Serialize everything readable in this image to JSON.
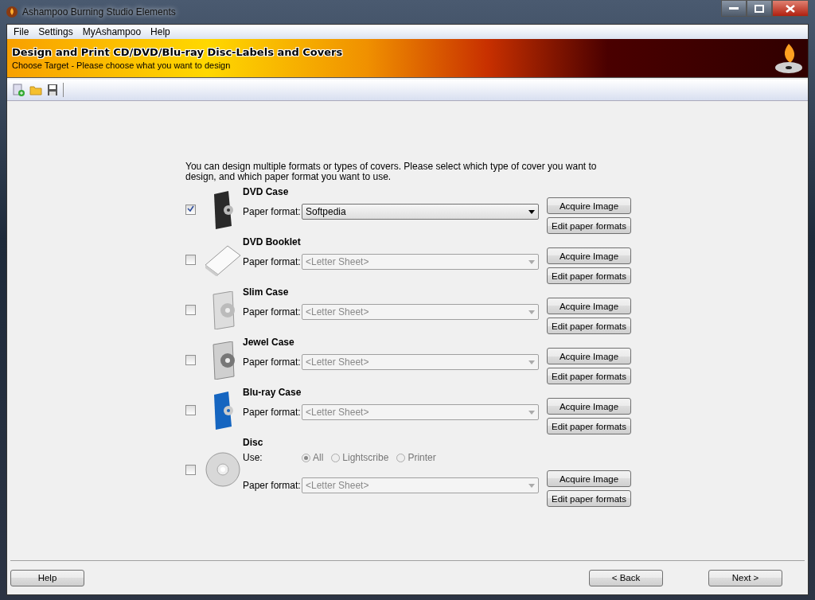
{
  "window": {
    "title": "Ashampoo Burning Studio Elements"
  },
  "menu": [
    "File",
    "Settings",
    "MyAshampoo",
    "Help"
  ],
  "banner": {
    "title": "Design and Print CD/DVD/Blu-ray Disc-Labels and Covers",
    "subtitle": "Choose Target - Please choose what you want to design"
  },
  "intro": "You can design multiple formats or types of covers. Please select which type of cover you want to design, and which paper format you want to use.",
  "items": [
    {
      "kind": "dvd-case",
      "name": "DVD Case",
      "checked": true,
      "paper_label": "Paper format:",
      "paper_value": "Softpedia",
      "buttons": [
        "Acquire Image",
        "Edit paper formats"
      ]
    },
    {
      "kind": "booklet",
      "name": "DVD Booklet",
      "checked": false,
      "paper_label": "Paper format:",
      "paper_value": "<Letter Sheet>",
      "buttons": [
        "Acquire Image",
        "Edit paper formats"
      ]
    },
    {
      "kind": "slim-case",
      "name": "Slim Case",
      "checked": false,
      "paper_label": "Paper format:",
      "paper_value": "<Letter Sheet>",
      "buttons": [
        "Acquire Image",
        "Edit paper formats"
      ]
    },
    {
      "kind": "jewel-case",
      "name": "Jewel Case",
      "checked": false,
      "paper_label": "Paper format:",
      "paper_value": "<Letter Sheet>",
      "buttons": [
        "Acquire Image",
        "Edit paper formats"
      ]
    },
    {
      "kind": "bluray-case",
      "name": "Blu-ray Case",
      "checked": false,
      "paper_label": "Paper format:",
      "paper_value": "<Letter Sheet>",
      "buttons": [
        "Acquire Image",
        "Edit paper formats"
      ]
    },
    {
      "kind": "disc",
      "name": "Disc",
      "checked": false,
      "use_label": "Use:",
      "use_options": [
        {
          "label": "All",
          "selected": true
        },
        {
          "label": "Lightscribe",
          "selected": false
        },
        {
          "label": "Printer",
          "selected": false
        }
      ],
      "paper_label": "Paper format:",
      "paper_value": "<Letter Sheet>",
      "buttons": [
        "Acquire Image",
        "Edit paper formats"
      ]
    }
  ],
  "footer": {
    "help": "Help",
    "back": "< Back",
    "next": "Next >"
  }
}
